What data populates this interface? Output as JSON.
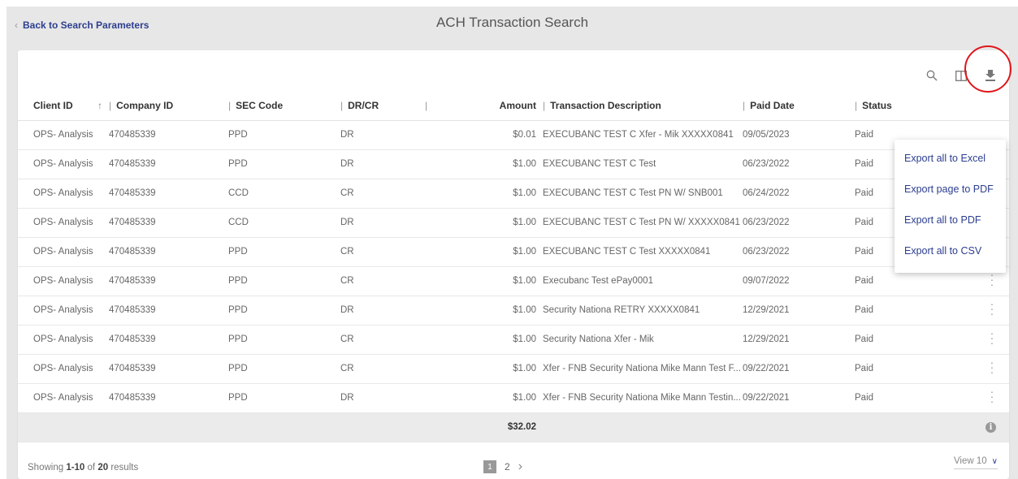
{
  "header": {
    "back_label": "Back to Search Parameters",
    "title": "ACH Transaction Search"
  },
  "toolbar": {
    "icons": [
      "search-icon",
      "columns-icon",
      "download-icon"
    ]
  },
  "columns": [
    "Client ID",
    "Company ID",
    "SEC Code",
    "DR/CR",
    "Amount",
    "Transaction Description",
    "Paid Date",
    "Status"
  ],
  "rows": [
    {
      "client": "OPS- Analysis",
      "company": "470485339",
      "sec": "PPD",
      "drcr": "DR",
      "amount": "$0.01",
      "desc": "EXECUBANC TEST C Xfer - Mik XXXXX0841",
      "paid_date": "09/05/2023",
      "status": "Paid"
    },
    {
      "client": "OPS- Analysis",
      "company": "470485339",
      "sec": "PPD",
      "drcr": "DR",
      "amount": "$1.00",
      "desc": "EXECUBANC TEST C Test",
      "paid_date": "06/23/2022",
      "status": "Paid"
    },
    {
      "client": "OPS- Analysis",
      "company": "470485339",
      "sec": "CCD",
      "drcr": "CR",
      "amount": "$1.00",
      "desc": "EXECUBANC TEST C Test PN W/ SNB001",
      "paid_date": "06/24/2022",
      "status": "Paid"
    },
    {
      "client": "OPS- Analysis",
      "company": "470485339",
      "sec": "CCD",
      "drcr": "DR",
      "amount": "$1.00",
      "desc": "EXECUBANC TEST C Test PN W/ XXXXX0841",
      "paid_date": "06/23/2022",
      "status": "Paid"
    },
    {
      "client": "OPS- Analysis",
      "company": "470485339",
      "sec": "PPD",
      "drcr": "CR",
      "amount": "$1.00",
      "desc": "EXECUBANC TEST C Test XXXXX0841",
      "paid_date": "06/23/2022",
      "status": "Paid"
    },
    {
      "client": "OPS- Analysis",
      "company": "470485339",
      "sec": "PPD",
      "drcr": "CR",
      "amount": "$1.00",
      "desc": "Execubanc Test ePay0001",
      "paid_date": "09/07/2022",
      "status": "Paid"
    },
    {
      "client": "OPS- Analysis",
      "company": "470485339",
      "sec": "PPD",
      "drcr": "DR",
      "amount": "$1.00",
      "desc": "Security Nationa RETRY XXXXX0841",
      "paid_date": "12/29/2021",
      "status": "Paid"
    },
    {
      "client": "OPS- Analysis",
      "company": "470485339",
      "sec": "PPD",
      "drcr": "CR",
      "amount": "$1.00",
      "desc": "Security Nationa Xfer - Mik",
      "paid_date": "12/29/2021",
      "status": "Paid"
    },
    {
      "client": "OPS- Analysis",
      "company": "470485339",
      "sec": "PPD",
      "drcr": "CR",
      "amount": "$1.00",
      "desc": "Xfer - FNB Security Nationa Mike Mann Test F...",
      "paid_date": "09/22/2021",
      "status": "Paid"
    },
    {
      "client": "OPS- Analysis",
      "company": "470485339",
      "sec": "PPD",
      "drcr": "DR",
      "amount": "$1.00",
      "desc": "Xfer - FNB Security Nationa Mike Mann Testin...",
      "paid_date": "09/22/2021",
      "status": "Paid"
    }
  ],
  "total": "$32.02",
  "footer": {
    "showing_prefix": "Showing ",
    "range": "1-10",
    "of": " of ",
    "count": "20",
    "suffix": " results",
    "pages": [
      "1",
      "2"
    ],
    "view_label": "View 10"
  },
  "export_menu": [
    "Export all to Excel",
    "Export page to PDF",
    "Export all to PDF",
    "Export all to CSV"
  ],
  "colors": {
    "link": "#2c3e8f",
    "annotation": "#e0161b"
  }
}
